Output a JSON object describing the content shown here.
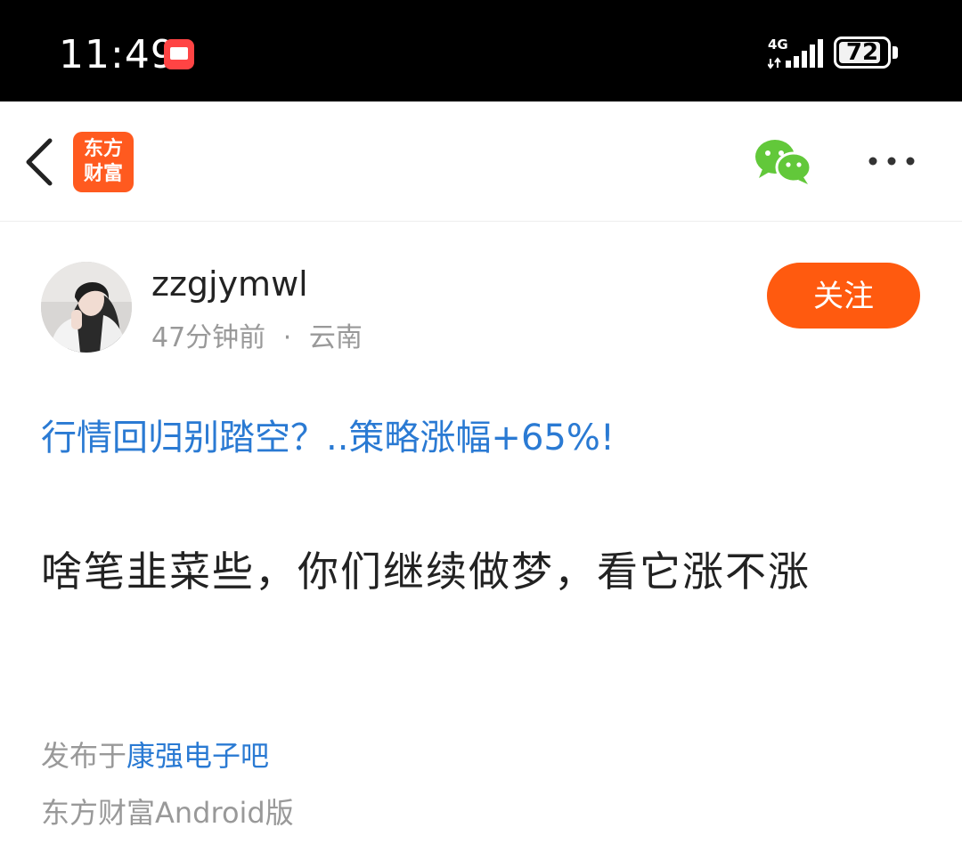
{
  "status_bar": {
    "time": "11:49",
    "network": "4G",
    "battery": "72",
    "notification_icon": "app-notification-icon"
  },
  "nav": {
    "logo_line1": "东方",
    "logo_line2": "财富",
    "share_icon": "wechat-icon",
    "more_icon": "more-dots-icon"
  },
  "post": {
    "author": "zzgjymwl",
    "time_ago": "47分钟前",
    "separator": "·",
    "location": "云南",
    "follow_label": "关注",
    "title": "行情回归别踏空？..策略涨幅+65%!",
    "body": "啥笔韭菜些，你们继续做梦，看它涨不涨",
    "published_prefix": "发布于",
    "forum": "康强电子吧",
    "client": "东方财富Android版"
  },
  "colors": {
    "accent": "#ff5a0f",
    "link": "#2a7ad3",
    "muted": "#999999",
    "wechat": "#62c83a"
  }
}
